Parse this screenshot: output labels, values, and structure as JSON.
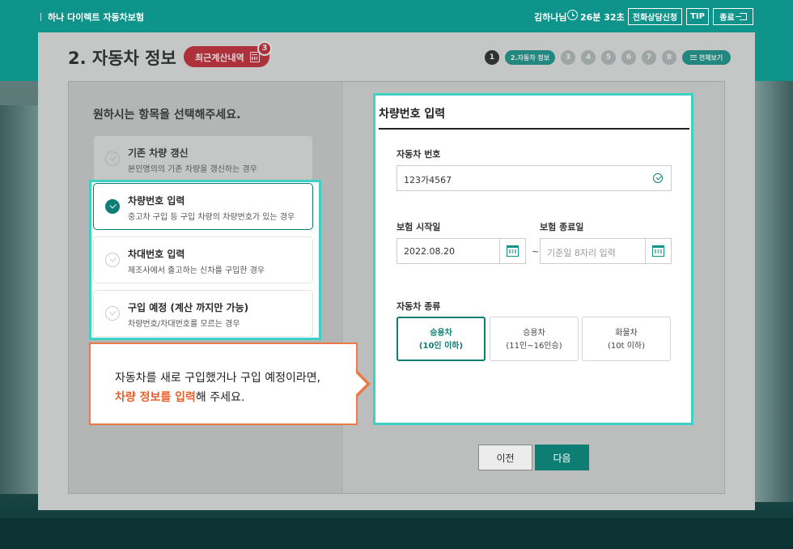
{
  "topbar": {
    "brand": "하나 다이렉트 자동차보험",
    "user": "김하나님",
    "timer": "26분 32초",
    "consult_label": "전화상담신청",
    "tip_label": "TIP",
    "exit_label": "종료"
  },
  "header": {
    "title": "2. 자동차 정보",
    "recent_label": "최근계산내역",
    "recent_count": "3"
  },
  "steps": {
    "items": [
      "1",
      "2.자동차 정보",
      "3",
      "4",
      "5",
      "6",
      "7",
      "8"
    ],
    "all_label": "전체보기"
  },
  "left": {
    "prompt": "원하시는 항목을 선택해주세요.",
    "options": [
      {
        "title": "기존 차량 갱신",
        "desc": "본인명의의 기존 차량을 갱신하는 경우"
      },
      {
        "title": "차량번호 입력",
        "desc": "중고차 구입 등 구입 차량의 차량번호가 있는 경우"
      },
      {
        "title": "차대번호 입력",
        "desc": "제조사에서 출고하는 신차를 구입한 경우"
      },
      {
        "title": "구입 예정 (계산 까지만 가능)",
        "desc": "차량번호/차대번호를 모르는 경우"
      }
    ]
  },
  "callout": {
    "line1": "자동차를 새로 구입했거나 구입 예정이라면,",
    "highlight": "차량 정보를 입력",
    "rest": "해 주세요."
  },
  "form": {
    "title": "차량번호 입력",
    "plate_label": "자동차 번호",
    "plate_value": "123가4567",
    "start_label": "보험 시작일",
    "start_value": "2022.08.20",
    "end_label": "보험 종료일",
    "end_placeholder": "기준일 8자리 입력",
    "tilde": "~",
    "type_label": "자동차 종류",
    "types": [
      {
        "line1": "승용차",
        "line2": "(10인 이하)"
      },
      {
        "line1": "승용차",
        "line2": "(11인~16인승)"
      },
      {
        "line1": "화물차",
        "line2": "(10t 이하)"
      }
    ]
  },
  "nav": {
    "prev_label": "이전",
    "next_label": "다음"
  }
}
